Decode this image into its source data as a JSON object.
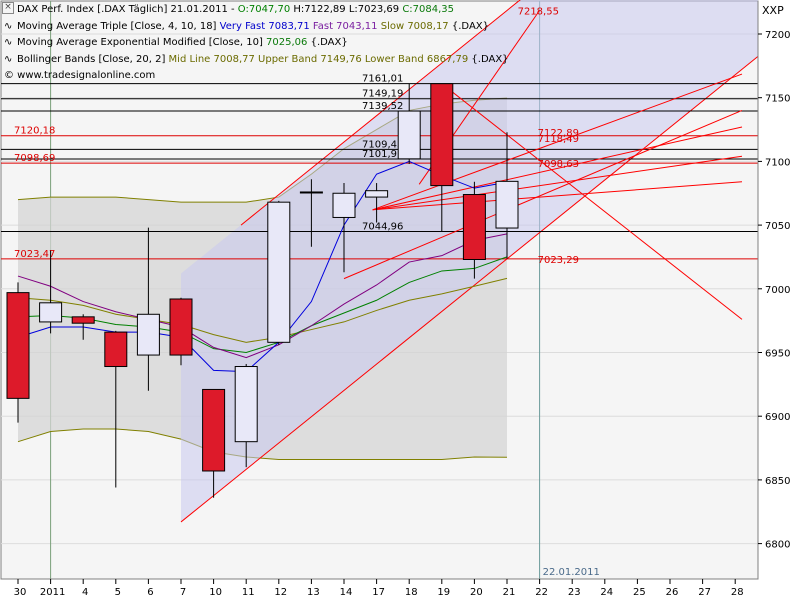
{
  "header": {
    "close_glyph": "×",
    "instrument_line": {
      "name": "DAX Perf. Index [.DAX  Täglich] 21.01.2011 - ",
      "open": "O:7047,70",
      "high": "H:7122,89",
      "low": "L:7023,69",
      "close": "C:7084,35"
    },
    "ma_triple": {
      "name": "Moving Average Triple [Close, 4, 10, 18]",
      "very_fast": "Very Fast 7083,71",
      "fast": "Fast 7043,11",
      "slow": "Slow 7008,17",
      "suffix": "{.DAX}"
    },
    "ema": {
      "name": "Moving Average Exponential Modified [Close, 10]",
      "value": "7025,06",
      "suffix": "{.DAX}"
    },
    "bollinger": {
      "name": "Bollinger Bands [Close, 20, 2]",
      "values": "Mid Line 7008,77 Upper Band 7149,76 Lower Band 6867,79",
      "suffix": "{.DAX}"
    },
    "copyright": "© www.tradesignalonline.com",
    "symbol": "XXP",
    "icon_names": [
      "close-icon",
      "ma-triple-icon",
      "ema-icon",
      "bollinger-icon"
    ]
  },
  "chart_data": {
    "type": "candlestick",
    "colors": {
      "up": "#e8e8f8",
      "down": "#dd1a2a",
      "ma_very_fast": "#0000dd",
      "ma_fast": "#800080",
      "ma_slow": "#808000",
      "ema": "#008000",
      "bollinger_fill": "#d4d4d4",
      "bollinger_line": "#808000",
      "channel_fill": "#c8c8ee",
      "trendline": "#ff0000",
      "level_line": "#000000"
    },
    "x_ticks": [
      "30",
      "2011",
      "4",
      "5",
      "6",
      "7",
      "10",
      "11",
      "12",
      "13",
      "14",
      "17",
      "18",
      "19",
      "20",
      "21",
      "22",
      "23",
      "24",
      "25",
      "26",
      "27",
      "28"
    ],
    "y_ticks": [
      6800,
      6850,
      6900,
      6950,
      7000,
      7050,
      7100,
      7150,
      7200
    ],
    "ylim": [
      6770,
      7227
    ],
    "candles": [
      {
        "date": "30",
        "o": 6997,
        "h": 7005,
        "l": 6895,
        "c": 6914
      },
      {
        "date": "2011",
        "o": 6974,
        "h": 7030,
        "l": 6965,
        "c": 6989
      },
      {
        "date": "4",
        "o": 6978,
        "h": 6980,
        "l": 6960,
        "c": 6973
      },
      {
        "date": "5",
        "o": 6966,
        "h": 6967,
        "l": 6844,
        "c": 6939
      },
      {
        "date": "6",
        "o": 6948,
        "h": 7048,
        "l": 6920,
        "c": 6980
      },
      {
        "date": "7",
        "o": 6992,
        "h": 6993,
        "l": 6940,
        "c": 6948
      },
      {
        "date": "10",
        "o": 6921,
        "h": 6921,
        "l": 6836,
        "c": 6857
      },
      {
        "date": "11",
        "o": 6880,
        "h": 6941,
        "l": 6860,
        "c": 6939
      },
      {
        "date": "12",
        "o": 6958,
        "h": 7069,
        "l": 6956,
        "c": 7068
      },
      {
        "date": "13",
        "o": 7076,
        "h": 7086,
        "l": 7033,
        "c": 7076
      },
      {
        "date": "14",
        "o": 7056,
        "h": 7083,
        "l": 7013,
        "c": 7075
      },
      {
        "date": "17",
        "o": 7072,
        "h": 7083,
        "l": 7052,
        "c": 7077
      },
      {
        "date": "18",
        "o": 7102,
        "h": 7161.01,
        "l": 7098,
        "c": 7139.52
      },
      {
        "date": "19",
        "o": 7161.01,
        "h": 7161.01,
        "l": 7044.96,
        "c": 7081
      },
      {
        "date": "20",
        "o": 7074,
        "h": 7084,
        "l": 7008,
        "c": 7023
      },
      {
        "date": "21",
        "o": 7047.7,
        "h": 7122.89,
        "l": 7023.69,
        "c": 7084.35
      }
    ],
    "ma_very_fast": [
      6962,
      6970,
      6970,
      6966,
      6966,
      6962,
      6936,
      6935,
      6958,
      6990,
      7050,
      7090,
      7100,
      7089,
      7079,
      7083.71
    ],
    "ma_fast": [
      7010,
      7002,
      6990,
      6982,
      6976,
      6970,
      6954,
      6946,
      6956,
      6971,
      6988,
      7003,
      7021,
      7026,
      7038,
      7043.11
    ],
    "ma_slow": [
      6993,
      6991,
      6987,
      6980,
      6976,
      6972,
      6964,
      6958,
      6962,
      6968,
      6974,
      6983,
      6991,
      6996,
      7002,
      7008.17
    ],
    "ema": [
      6978,
      6979,
      6977,
      6972,
      6970,
      6966,
      6953,
      6950,
      6958,
      6971,
      6981,
      6991,
      7005,
      7014,
      7016,
      7025.06
    ],
    "bollinger_upper": [
      7070,
      7072,
      7072,
      7072,
      7070,
      7068,
      7068,
      7068,
      7072,
      7090,
      7110,
      7125,
      7140,
      7145,
      7148,
      7149.76
    ],
    "bollinger_lower": [
      6880,
      6888,
      6890,
      6890,
      6888,
      6882,
      6872,
      6868,
      6866,
      6866,
      6866,
      6866,
      6866,
      6866,
      6868,
      6867.79
    ],
    "level_lines": [
      {
        "value": 7161.01,
        "label": "7161,01",
        "color": "#000000"
      },
      {
        "value": 7149.19,
        "label": "7149,19",
        "color": "#000000"
      },
      {
        "value": 7139.52,
        "label": "7139,52",
        "color": "#000000"
      },
      {
        "value": 7109.43,
        "label": "7109,43",
        "color": "#000000"
      },
      {
        "value": 7101.91,
        "label": "7101,91",
        "color": "#000000"
      },
      {
        "value": 7044.96,
        "label": "7044,96",
        "color": "#000000"
      },
      {
        "value": 7120.18,
        "label": "7120,18",
        "color": "#dd0000"
      },
      {
        "value": 7098.69,
        "label": "7098,69",
        "color": "#dd0000"
      },
      {
        "value": 7023.47,
        "label": "7023,47",
        "color": "#dd0000"
      }
    ],
    "price_labels": [
      {
        "text": "7218,55",
        "color": "#dd0000"
      },
      {
        "text": "7122,89",
        "color": "#dd0000"
      },
      {
        "text": "7118,49",
        "color": "#dd0000"
      },
      {
        "text": "7098,63",
        "color": "#dd0000"
      },
      {
        "text": "7023,29",
        "color": "#dd0000"
      },
      {
        "text": "7000",
        "color": "#dd0000"
      }
    ],
    "date_marker": "22.01.2011"
  }
}
